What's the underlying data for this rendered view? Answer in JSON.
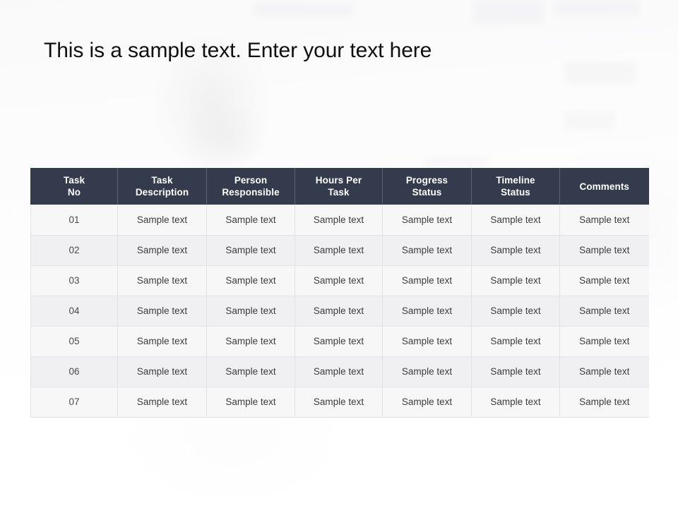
{
  "slide": {
    "title": "This is a sample text. Enter your text here",
    "header_bg_color": "#333b4c",
    "header_text_color": "#ffffff",
    "title_color": "#101010",
    "row_odd_color": "#f6f6f7",
    "row_even_color": "#eeeef0",
    "cell_text_color": "#3c3c3c",
    "grid_line_color": "#e2e2e4"
  },
  "table": {
    "columns": [
      {
        "line1": "Task",
        "line2": "No"
      },
      {
        "line1": "Task",
        "line2": "Description"
      },
      {
        "line1": "Person",
        "line2": "Responsible"
      },
      {
        "line1": "Hours Per",
        "line2": "Task"
      },
      {
        "line1": "Progress",
        "line2": "Status"
      },
      {
        "line1": "Timeline",
        "line2": "Status"
      },
      {
        "line1": "Comments",
        "line2": ""
      }
    ],
    "rows": [
      {
        "task_no": "01",
        "task_description": "Sample text",
        "person_responsible": "Sample text",
        "hours_per_task": "Sample text",
        "progress_status": "Sample text",
        "timeline_status": "Sample text",
        "comments": "Sample text"
      },
      {
        "task_no": "02",
        "task_description": "Sample text",
        "person_responsible": "Sample text",
        "hours_per_task": "Sample text",
        "progress_status": "Sample text",
        "timeline_status": "Sample text",
        "comments": "Sample text"
      },
      {
        "task_no": "03",
        "task_description": "Sample text",
        "person_responsible": "Sample text",
        "hours_per_task": "Sample text",
        "progress_status": "Sample text",
        "timeline_status": "Sample text",
        "comments": "Sample text"
      },
      {
        "task_no": "04",
        "task_description": "Sample text",
        "person_responsible": "Sample text",
        "hours_per_task": "Sample text",
        "progress_status": "Sample text",
        "timeline_status": "Sample text",
        "comments": "Sample text"
      },
      {
        "task_no": "05",
        "task_description": "Sample text",
        "person_responsible": "Sample text",
        "hours_per_task": "Sample text",
        "progress_status": "Sample text",
        "timeline_status": "Sample text",
        "comments": "Sample text"
      },
      {
        "task_no": "06",
        "task_description": "Sample text",
        "person_responsible": "Sample text",
        "hours_per_task": "Sample text",
        "progress_status": "Sample text",
        "timeline_status": "Sample text",
        "comments": "Sample text"
      },
      {
        "task_no": "07",
        "task_description": "Sample text",
        "person_responsible": "Sample text",
        "hours_per_task": "Sample text",
        "progress_status": "Sample text",
        "timeline_status": "Sample text",
        "comments": "Sample text"
      }
    ]
  }
}
